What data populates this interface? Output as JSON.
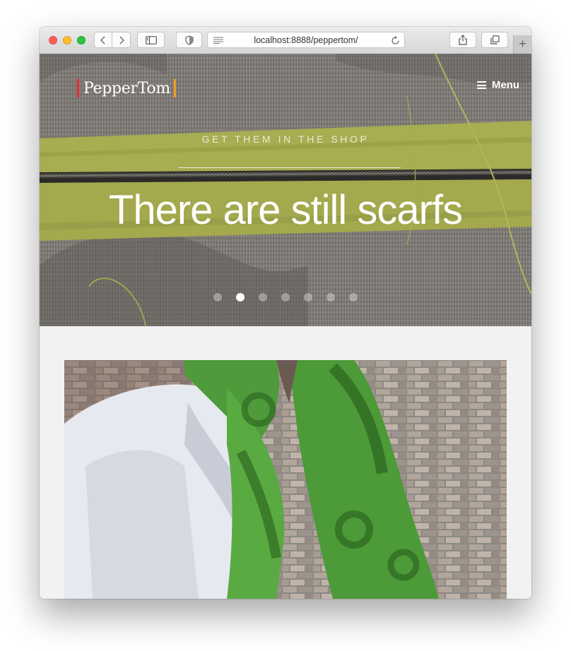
{
  "browser": {
    "url": "localhost:8888/peppertom/",
    "new_tab": "+"
  },
  "site": {
    "logo": "PepperTom",
    "menu_label": "Menu"
  },
  "hero": {
    "eyebrow": "GET THEM IN THE SHOP",
    "headline": "There are still scarfs",
    "slide_count": 7,
    "active_slide": 2
  },
  "colors": {
    "logo_bar_left": "#e8282b",
    "logo_bar_right": "#f29b1d",
    "zipper_tape": "#a7ad51",
    "scarf_green": "#4f9a3a"
  },
  "icons": [
    "back-icon",
    "forward-icon",
    "sidebar-icon",
    "shield-icon",
    "reader-icon",
    "reload-icon",
    "share-icon",
    "tabs-icon",
    "hamburger-icon"
  ]
}
